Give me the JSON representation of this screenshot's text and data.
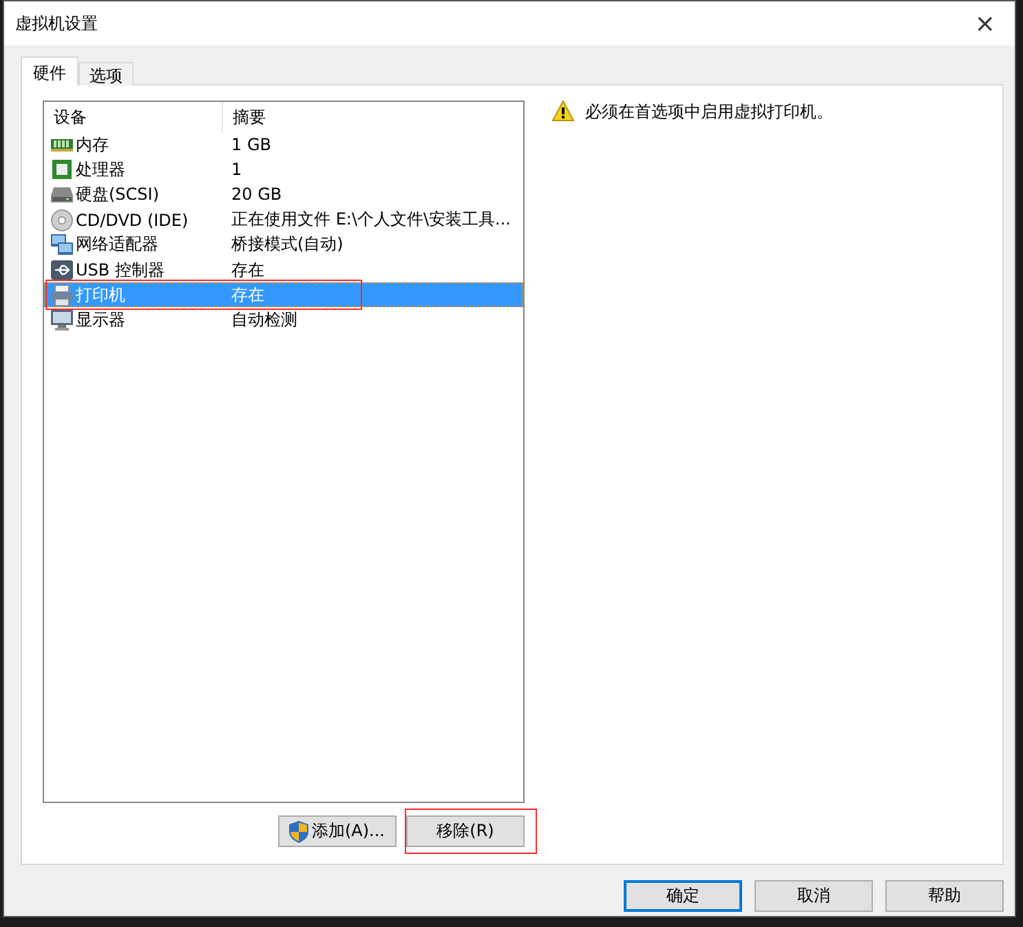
{
  "window": {
    "title": "虚拟机设置",
    "close": "×"
  },
  "tabs": [
    {
      "label": "硬件",
      "selected": true
    },
    {
      "label": "选项",
      "selected": false
    }
  ],
  "device_list": {
    "columns": [
      "设备",
      "摘要"
    ],
    "rows": [
      {
        "kind": "memory",
        "device": "内存",
        "summary": "1 GB",
        "selected": false,
        "highlighted": false
      },
      {
        "kind": "cpu",
        "device": "处理器",
        "summary": "1",
        "selected": false,
        "highlighted": false
      },
      {
        "kind": "disk",
        "device": "硬盘(SCSI)",
        "summary": "20 GB",
        "selected": false,
        "highlighted": false
      },
      {
        "kind": "cdrom",
        "device": "CD/DVD (IDE)",
        "summary": "正在使用文件 E:\\个人文件\\安装工具...",
        "selected": false,
        "highlighted": false
      },
      {
        "kind": "network",
        "device": "网络适配器",
        "summary": "桥接模式(自动)",
        "selected": false,
        "highlighted": false
      },
      {
        "kind": "usb",
        "device": "USB 控制器",
        "summary": "存在",
        "selected": false,
        "highlighted": false
      },
      {
        "kind": "printer",
        "device": "打印机",
        "summary": "存在",
        "selected": true,
        "highlighted": true
      },
      {
        "kind": "display",
        "device": "显示器",
        "summary": "自动检测",
        "selected": false,
        "highlighted": false
      }
    ]
  },
  "list_buttons": [
    {
      "label": "添加(A)...",
      "shield": true,
      "highlighted": false
    },
    {
      "label": "移除(R)",
      "shield": false,
      "highlighted": true
    }
  ],
  "warning": "必须在首选项中启用虚拟打印机。",
  "footer_buttons": [
    {
      "label": "确定",
      "default": true
    },
    {
      "label": "取消",
      "default": false
    },
    {
      "label": "帮助",
      "default": false
    }
  ]
}
